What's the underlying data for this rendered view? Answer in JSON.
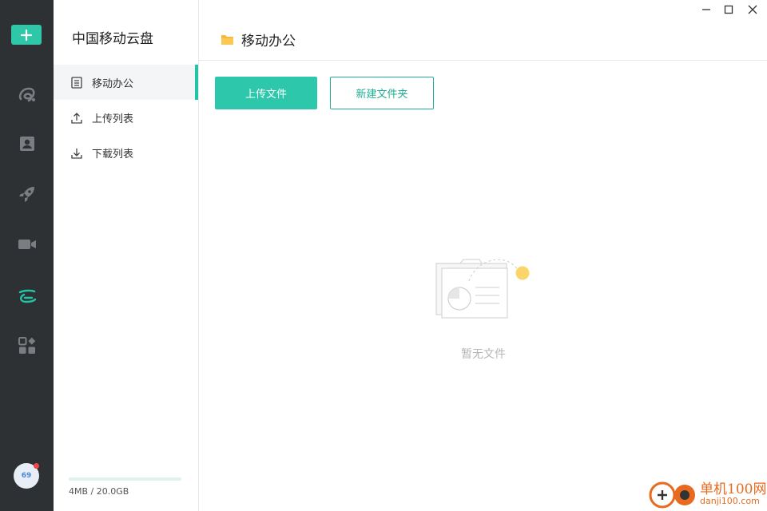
{
  "rail": {
    "items": [
      {
        "icon": "cloud-a-icon",
        "label": ""
      },
      {
        "icon": "contact-card-icon",
        "label": ""
      },
      {
        "icon": "rocket-icon",
        "label": ""
      },
      {
        "icon": "video-camera-icon",
        "label": ""
      },
      {
        "icon": "cloud-disk-icon",
        "label": "",
        "active": true
      },
      {
        "icon": "apps-grid-icon",
        "label": ""
      }
    ],
    "avatar_text": "69"
  },
  "sidebar": {
    "title": "中国移动云盘",
    "items": [
      {
        "label": "移动办公",
        "icon": "document-list-icon",
        "active": true
      },
      {
        "label": "上传列表",
        "icon": "upload-icon"
      },
      {
        "label": "下载列表",
        "icon": "download-icon"
      }
    ],
    "storage": {
      "used_fraction": 0.0002,
      "text": "4MB / 20.0GB"
    }
  },
  "main": {
    "path": "移动办公",
    "upload_button": "上传文件",
    "new_folder_button": "新建文件夹",
    "empty_text": "暂无文件"
  },
  "watermark": {
    "title": "单机100网",
    "subtitle": "danji100.com"
  },
  "colors": {
    "accent": "#2dc8ab",
    "rail_bg": "#2e3133",
    "folder": "#f6b93b"
  }
}
